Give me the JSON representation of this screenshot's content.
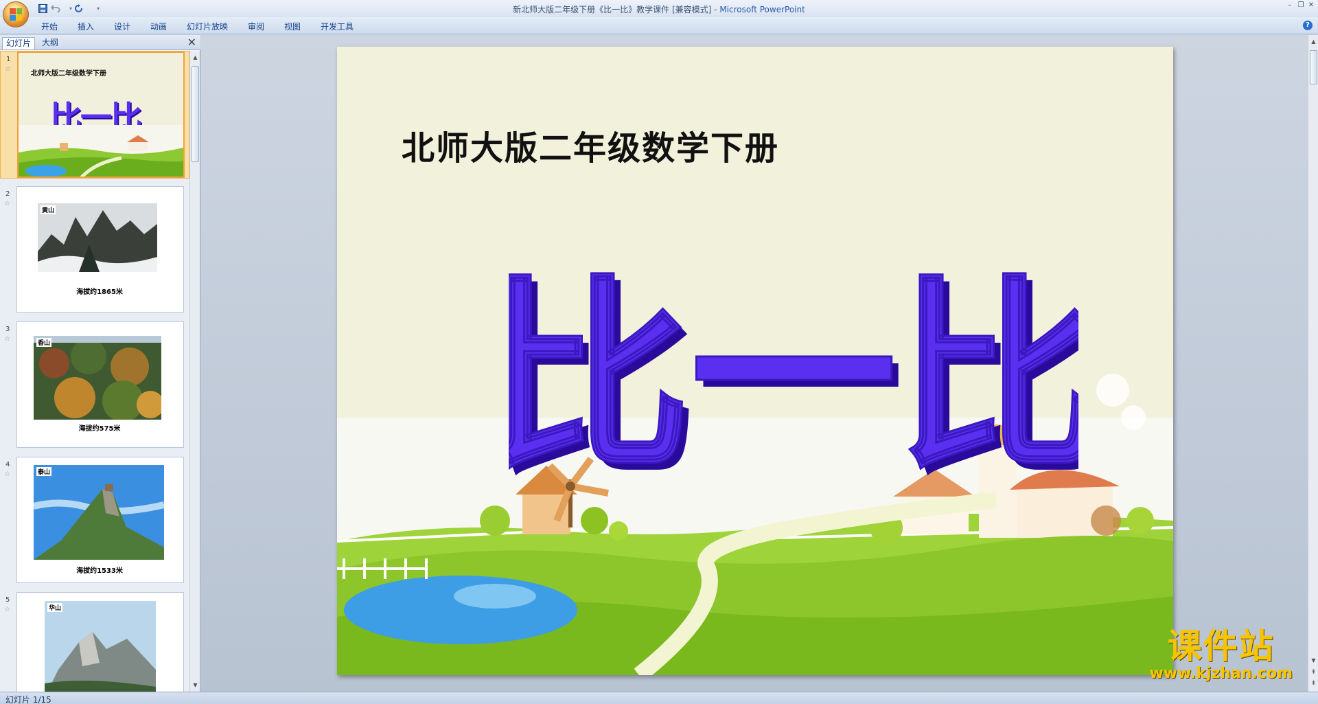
{
  "window": {
    "title_doc": "新北师大版二年级下册《比一比》教学课件 [兼容模式]",
    "title_sep": " - ",
    "title_app": "Microsoft PowerPoint"
  },
  "ribbon": {
    "tabs": [
      "开始",
      "插入",
      "设计",
      "动画",
      "幻灯片放映",
      "审阅",
      "视图",
      "开发工具"
    ]
  },
  "left_pane": {
    "tabs": [
      "幻灯片",
      "大纲"
    ],
    "close_glyph": "✕"
  },
  "slides": [
    {
      "num": "1",
      "subtitle": "北师大版二年级数学下册",
      "title": "比一比"
    },
    {
      "num": "2",
      "label": "黄山",
      "caption": "海拔约1865米"
    },
    {
      "num": "3",
      "label": "香山",
      "caption": "海拔约575米"
    },
    {
      "num": "4",
      "label": "泰山",
      "caption": "海拔约1533米"
    },
    {
      "num": "5",
      "label": "华山",
      "caption": ""
    }
  ],
  "current_slide": {
    "subtitle": "北师大版二年级数学下册",
    "title": "比一比"
  },
  "status": {
    "slide_indicator": "幻灯片 1/15"
  },
  "watermark": {
    "main": "课件站",
    "url": "www.kjzhan.com"
  },
  "colors": {
    "title_purple": "#5a2ff0",
    "title_shadow": "#2a0a9a",
    "selected_orange": "#f0a33a",
    "ribbon_text": "#15428b",
    "watermark_yellow": "#f6c400"
  },
  "icons": [
    "office-button-icon",
    "save-icon",
    "undo-icon",
    "redo-icon",
    "qat-dropdown-icon",
    "minimize-icon",
    "restore-icon",
    "close-icon",
    "help-icon",
    "pane-close-icon"
  ]
}
